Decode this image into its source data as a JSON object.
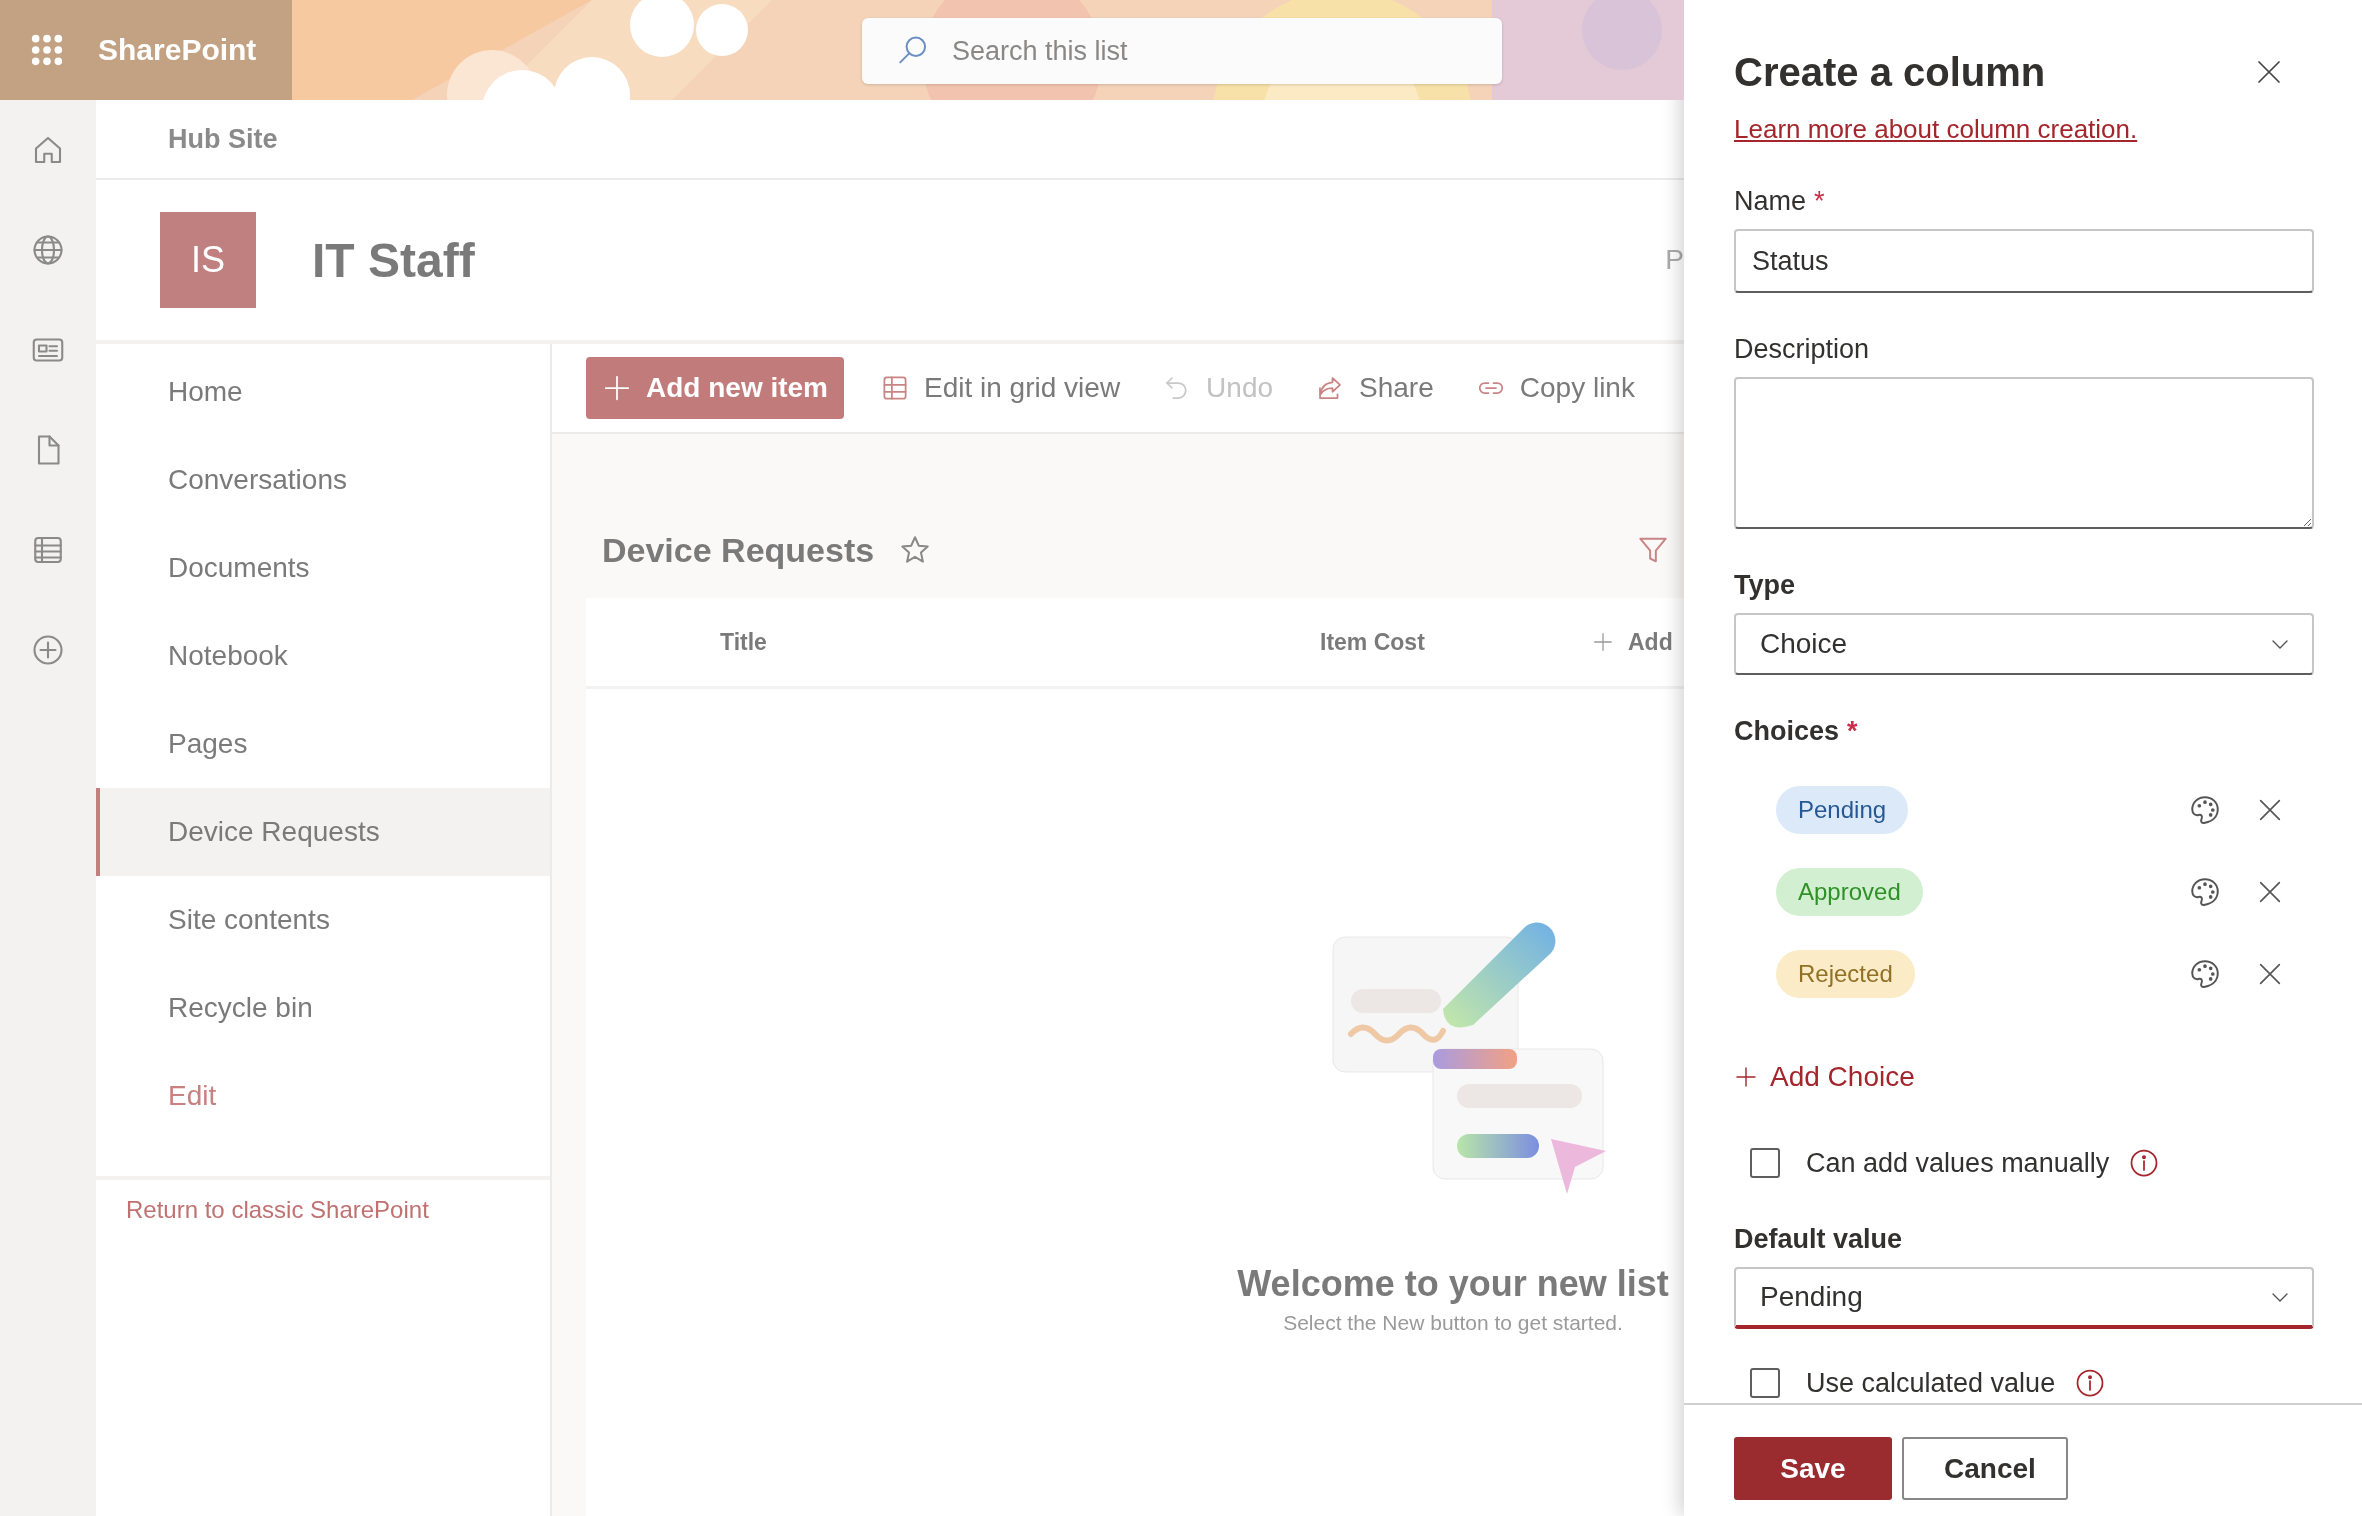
{
  "app_bar": {
    "app_name": "SharePoint",
    "search": {
      "placeholder": "Search this list"
    }
  },
  "hub": {
    "name": "Hub Site"
  },
  "site": {
    "logo": "IS",
    "title": "IT Staff",
    "cut_text": "P"
  },
  "nav": {
    "items": [
      {
        "label": "Home",
        "kind": "link",
        "selected": false
      },
      {
        "label": "Conversations",
        "kind": "link",
        "selected": false
      },
      {
        "label": "Documents",
        "kind": "link",
        "selected": false
      },
      {
        "label": "Notebook",
        "kind": "link",
        "selected": false
      },
      {
        "label": "Pages",
        "kind": "link",
        "selected": false
      },
      {
        "label": "Device Requests",
        "kind": "link",
        "selected": true
      },
      {
        "label": "Site contents",
        "kind": "link",
        "selected": false
      },
      {
        "label": "Recycle bin",
        "kind": "link",
        "selected": false
      },
      {
        "label": "Edit",
        "kind": "edit",
        "selected": false
      }
    ],
    "footer_link": "Return to classic SharePoint"
  },
  "command_bar": [
    {
      "label": "Add new item",
      "kind": "add",
      "disabled": false
    },
    {
      "label": "Edit in grid view",
      "kind": "grid",
      "disabled": false
    },
    {
      "label": "Undo",
      "kind": "undo",
      "disabled": true
    },
    {
      "label": "Share",
      "kind": "share",
      "disabled": false
    },
    {
      "label": "Copy link",
      "kind": "link",
      "disabled": false
    }
  ],
  "list": {
    "title": "Device Requests",
    "favorite": false,
    "columns": [
      "Title",
      "Item Cost"
    ],
    "add_column": "Add",
    "empty": {
      "heading": "Welcome to your new list",
      "hint": "Select the New button to get started."
    }
  },
  "panel": {
    "title": "Create a column",
    "learn_link": "Learn more about column creation.",
    "fields": [
      {
        "kind": "text",
        "label": "Name",
        "required_mark": "*",
        "value": "Status"
      },
      {
        "kind": "textarea",
        "label": "Description"
      },
      {
        "kind": "dropdown",
        "label": "Type",
        "value": "Choice",
        "focused": false
      },
      {
        "kind": "choices",
        "label": "Choices",
        "required_mark": "*",
        "items": [
          {
            "label": "Pending",
            "color": "#dce9f8"
          },
          {
            "label": "Approved",
            "color": "#d3efd1"
          },
          {
            "label": "Rejected",
            "color": "#fbebc6"
          }
        ]
      },
      {
        "kind": "add",
        "label": "Add Choice"
      },
      {
        "kind": "checkbox",
        "label": "Can add values manually",
        "checked": false,
        "info": true
      },
      {
        "kind": "dropdown",
        "label": "Default value",
        "value": "Pending",
        "focused": true
      },
      {
        "kind": "checkbox",
        "label": "Use calculated value",
        "checked": false,
        "info": true
      }
    ],
    "buttons": [
      {
        "label": "Save",
        "kind": "primary"
      },
      {
        "label": "Cancel",
        "kind": "default"
      }
    ]
  }
}
